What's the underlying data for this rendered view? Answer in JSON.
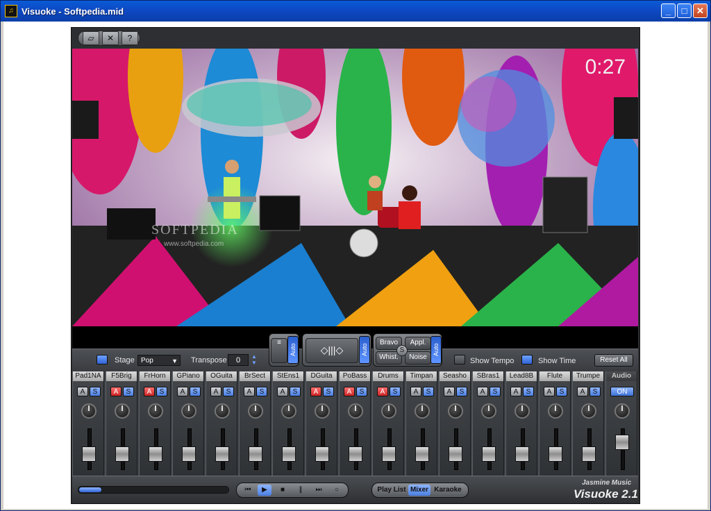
{
  "window": {
    "title": "Visuoke - Softpedia.mid",
    "app_icon": "music-notes-icon"
  },
  "toolbar": {
    "icons": [
      "folder-open-icon",
      "tools-icon",
      "help-icon"
    ]
  },
  "stage": {
    "time": "0:27",
    "watermark": "SOFTPEDIA",
    "watermark_url": "www.softpedia.com"
  },
  "stage_controls": {
    "stage_label": "Stage",
    "stage_value": "Pop",
    "transpose_label": "Transpose",
    "transpose_value": "0",
    "show_tempo_label": "Show Tempo",
    "show_time_label": "Show Time",
    "reset_label": "Reset All",
    "auto_label": "Auto",
    "fx": {
      "bravo": "Bravo",
      "appl": "Appl.",
      "whist": "Whist.",
      "noise": "Noise",
      "s": "S"
    }
  },
  "channels": [
    {
      "name": "Pad1NA",
      "a_on": false,
      "fader": 0.55
    },
    {
      "name": "F5Brig",
      "a_on": true,
      "fader": 0.55
    },
    {
      "name": "FrHorn",
      "a_on": true,
      "fader": 0.55
    },
    {
      "name": "GPiano",
      "a_on": false,
      "fader": 0.55
    },
    {
      "name": "OGuita",
      "a_on": false,
      "fader": 0.55
    },
    {
      "name": "BrSect",
      "a_on": false,
      "fader": 0.55
    },
    {
      "name": "StEns1",
      "a_on": false,
      "fader": 0.55
    },
    {
      "name": "DGuita",
      "a_on": true,
      "fader": 0.55
    },
    {
      "name": "PoBass",
      "a_on": true,
      "fader": 0.55
    },
    {
      "name": "Drums",
      "a_on": true,
      "fader": 0.55
    },
    {
      "name": "Timpan",
      "a_on": false,
      "fader": 0.55
    },
    {
      "name": "Seasho",
      "a_on": false,
      "fader": 0.55
    },
    {
      "name": "SBras1",
      "a_on": false,
      "fader": 0.55
    },
    {
      "name": "Lead8B",
      "a_on": false,
      "fader": 0.55
    },
    {
      "name": "Flute",
      "a_on": false,
      "fader": 0.55
    },
    {
      "name": "Trumpe",
      "a_on": false,
      "fader": 0.55
    }
  ],
  "audio": {
    "name": "Audio",
    "on_label": "ON",
    "fader": 0.85
  },
  "ab_labels": {
    "a": "A",
    "s": "S"
  },
  "transport": {
    "progress": 0.15,
    "icons": [
      "skip-back-icon",
      "play-icon",
      "stop-icon",
      "pause-icon",
      "skip-forward-icon",
      "loop-icon"
    ],
    "modes": [
      "Play List",
      "Mixer",
      "Karaoke"
    ],
    "active_mode": "Mixer"
  },
  "brand": {
    "company": "Jasmine Music",
    "product": "Visuoke 2.1"
  }
}
